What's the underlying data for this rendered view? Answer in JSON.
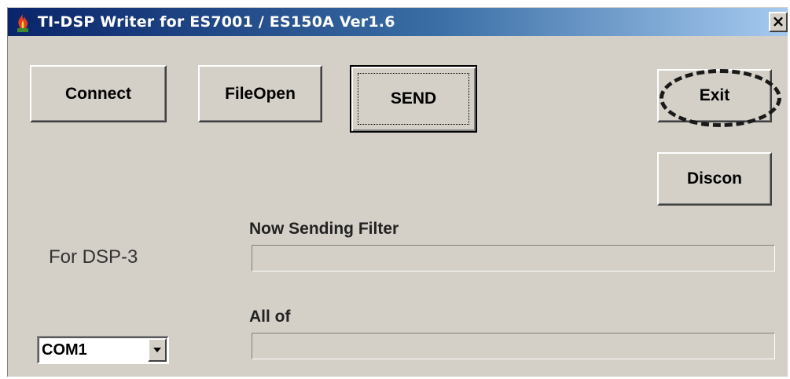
{
  "window": {
    "title": "TI-DSP Writer for ES7001 / ES150A Ver1.6",
    "close_glyph": "×",
    "icon": "app-flame-icon"
  },
  "buttons": {
    "connect": "Connect",
    "fileopen": "FileOpen",
    "send": "SEND",
    "exit": "Exit",
    "discon": "Discon"
  },
  "labels": {
    "dsp": "For DSP-3",
    "now_sending": "Now Sending Filter",
    "all_of": "All of"
  },
  "progress": {
    "now_sending_filter": 0,
    "all_of": 0
  },
  "port_select": {
    "value": "COM1"
  },
  "colors": {
    "face": "#d4d0c8",
    "title_start": "#0a246a",
    "title_end": "#a6caf0"
  }
}
